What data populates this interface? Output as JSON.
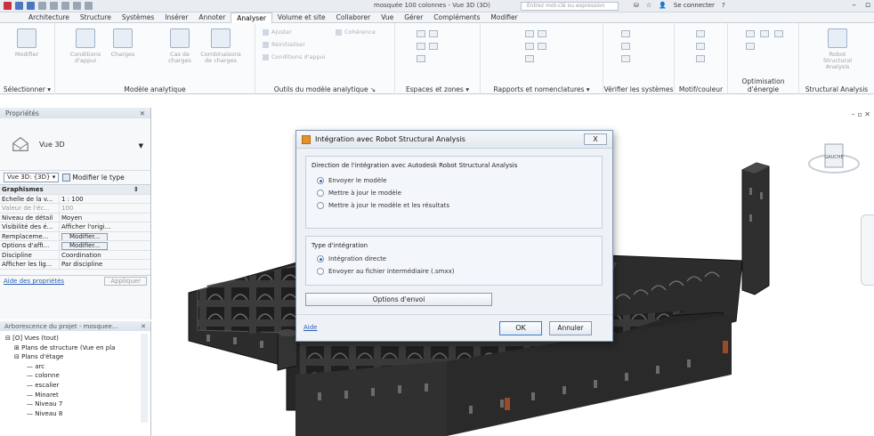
{
  "titlebar": {
    "doc_title": "mosquée 100 colonnes - Vue 3D (3D)",
    "search_placeholder": "Entrez mot-clé ou expression",
    "signin": "Se connecter"
  },
  "tabs": [
    "Architecture",
    "Structure",
    "Systèmes",
    "Insérer",
    "Annoter",
    "Analyser",
    "Volume et site",
    "Collaborer",
    "Vue",
    "Gérer",
    "Compléments",
    "Modifier"
  ],
  "active_tab": "Analyser",
  "ribbon": {
    "modify_label": "Modifier",
    "select_label": "Sélectionner",
    "loads_cond": "Conditions d'appui",
    "loads": "Charges",
    "load_cases": "Cas de charges",
    "load_combos": "Combinaisons de charges",
    "adjust": "Ajuster",
    "reset": "Réinitialiser",
    "consistency": "Cohérence",
    "support_cond": "Conditions d'appui",
    "group_model": "Modèle analytique",
    "group_tools": "Outils du modèle analytique",
    "group_spaces": "Espaces et zones",
    "group_reports": "Rapports et nomenclatures",
    "group_check": "Vérifier les systèmes",
    "group_color": "Motif/couleur",
    "group_energy": "Optimisation d'énergie",
    "group_rsa": "Structural Analysis",
    "robot_label": "Robot Structural Analysis"
  },
  "properties": {
    "title": "Propriétés",
    "type_name": "Vue 3D",
    "selector": "Vue 3D: {3D}",
    "edit_type": "Modifier le type",
    "category": "Graphismes",
    "rows": [
      {
        "k": "Echelle de la v...",
        "v": "1 : 100"
      },
      {
        "k": "Valeur de l'éc...",
        "v": "100"
      },
      {
        "k": "Niveau de détail",
        "v": "Moyen"
      },
      {
        "k": "Visibilité des é...",
        "v": "Afficher l'origi..."
      },
      {
        "k": "Remplaceme...",
        "v": "Modifier..."
      },
      {
        "k": "Options d'affi...",
        "v": "Modifier..."
      },
      {
        "k": "Discipline",
        "v": "Coordination"
      },
      {
        "k": "Afficher les lig...",
        "v": "Par discipline"
      }
    ],
    "help_link": "Aide des propriétés",
    "apply": "Appliquer"
  },
  "browser": {
    "title": "Arborescence du projet - mosquee...",
    "items": [
      {
        "text": "Vues (tout)",
        "level": 0,
        "prefix": "⊟ [O] "
      },
      {
        "text": "Plans de structure (Vue en pla",
        "level": 1,
        "prefix": "⊞ "
      },
      {
        "text": "Plans d'étage",
        "level": 1,
        "prefix": "⊟ "
      },
      {
        "text": "arc",
        "level": 2,
        "prefix": ""
      },
      {
        "text": "colonne",
        "level": 2,
        "prefix": ""
      },
      {
        "text": "escalier",
        "level": 2,
        "prefix": ""
      },
      {
        "text": "Minaret",
        "level": 2,
        "prefix": ""
      },
      {
        "text": "Niveau 7",
        "level": 2,
        "prefix": ""
      },
      {
        "text": "Niveau 8",
        "level": 2,
        "prefix": ""
      }
    ]
  },
  "dialog": {
    "title": "Intégration avec Robot Structural Analysis",
    "close": "X",
    "direction_legend": "Direction de l'intégration avec Autodesk Robot Structural Analysis",
    "direction_options": [
      "Envoyer le modèle",
      "Mettre à jour le modèle",
      "Mettre à jour le modèle et les résultats"
    ],
    "direction_selected": 0,
    "type_legend": "Type d'intégration",
    "type_options": [
      "Intégration directe",
      "Envoyer au fichier intermédiaire (.smxx)"
    ],
    "type_selected": 0,
    "options_button": "Options d'envoi",
    "help": "Aide",
    "ok": "OK",
    "cancel": "Annuler"
  },
  "viewcube_label": "GAUCHE"
}
